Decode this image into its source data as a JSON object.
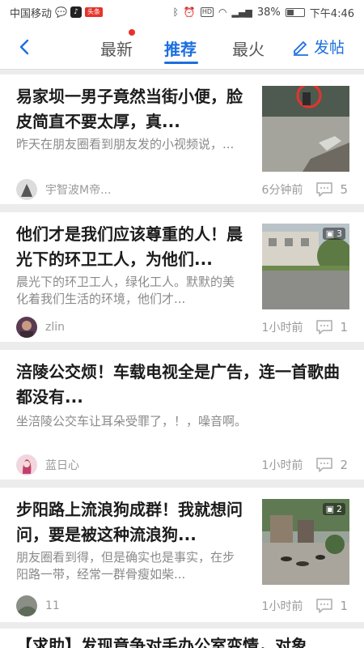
{
  "status_bar": {
    "carrier": "中国移动",
    "battery": "38%",
    "time": "下午4:46",
    "hd_label": "HD",
    "red_badge": "头条",
    "battery_level": 0.38
  },
  "nav": {
    "tabs": [
      {
        "label": "最新",
        "has_dot": true
      },
      {
        "label": "推荐",
        "active": true
      },
      {
        "label": "最火"
      }
    ],
    "post_label": "发帖",
    "accent_color": "#1b6fe0"
  },
  "posts": [
    {
      "title": "易家坝一男子竟然当街小便，脸皮简直不要太厚，真...",
      "summary": "昨天在朋友圈看到朋友发的小视频说，...",
      "author": "宇智波M帝...",
      "time": "6分钟前",
      "comments": "5",
      "image": "street-photo"
    },
    {
      "title": "他们才是我们应该尊重的人！晨光下的环卫工人，为他们...",
      "summary": "晨光下的环卫工人，绿化工人。默默的美化着我们生活的环境，他们才...",
      "author": "zlin",
      "time": "1小时前",
      "comments": "1",
      "image_count": "3",
      "image": "road-photo"
    },
    {
      "title": "涪陵公交烦！车载电视全是广告，连一首歌曲都没有...",
      "summary": "坐涪陵公交车让耳朵受罪了，！，噪音啊。",
      "author": "蓝日心",
      "time": "1小时前",
      "comments": "2"
    },
    {
      "title": "步阳路上流浪狗成群！我就想问问，要是被这种流浪狗...",
      "summary": "朋友圈看到得，但是确实也是事实，在步阳路一带，经常一群骨瘦如柴...",
      "author": "11",
      "time": "1小时前",
      "comments": "1",
      "image_count": "2",
      "image": "dogs-photo"
    },
    {
      "title": "【求助】发现竟争对手办公室变情，对象..."
    }
  ]
}
